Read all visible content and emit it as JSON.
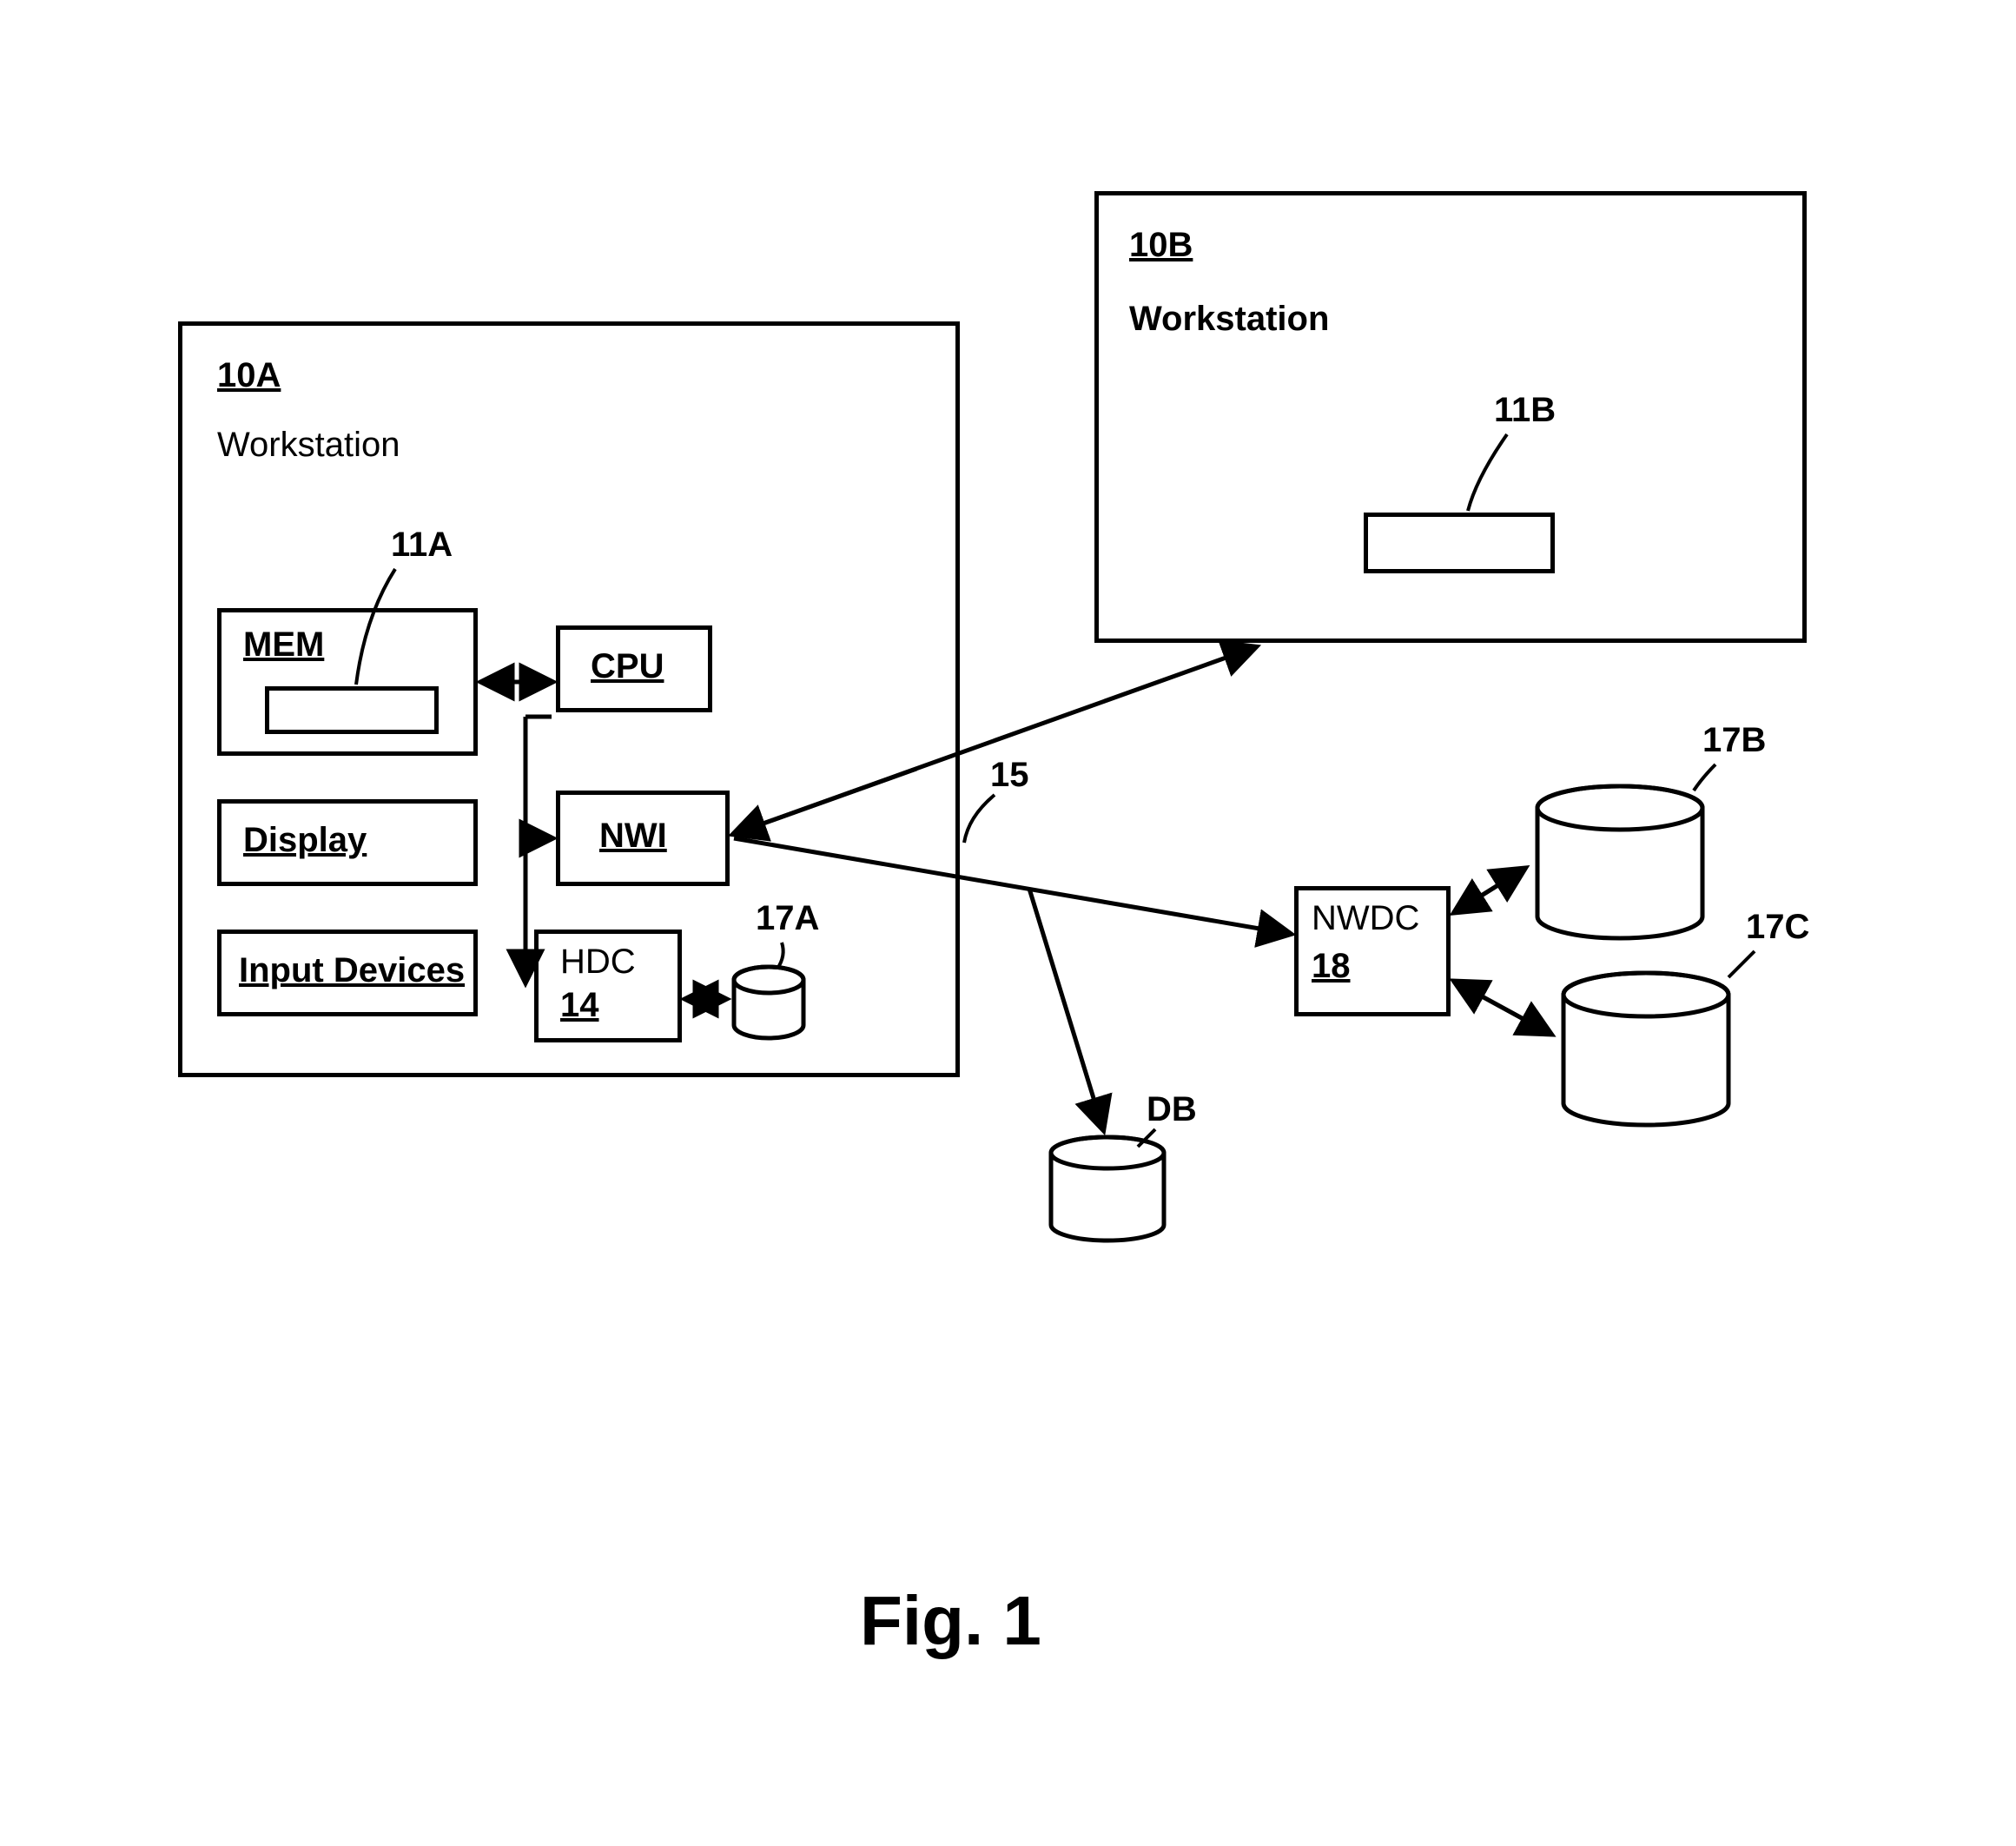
{
  "figure_title": "Fig. 1",
  "workstation_a": {
    "ref": "10A",
    "name": "Workstation",
    "mem_label": "MEM",
    "mem_callout": "11A",
    "cpu_label": "CPU",
    "nwi_label": "NWI",
    "display_label": "Display",
    "input_devices_label": "Input Devices",
    "hdc_label": "HDC",
    "hdc_ref": "14",
    "disk_a_callout": "17A"
  },
  "workstation_b": {
    "ref": "10B",
    "name": "Workstation",
    "mem_callout": "11B"
  },
  "network": {
    "ref": "15",
    "nwdc_label": "NWDC",
    "nwdc_ref": "18",
    "disk_b_callout": "17B",
    "disk_c_callout": "17C",
    "db_label": "DB"
  }
}
